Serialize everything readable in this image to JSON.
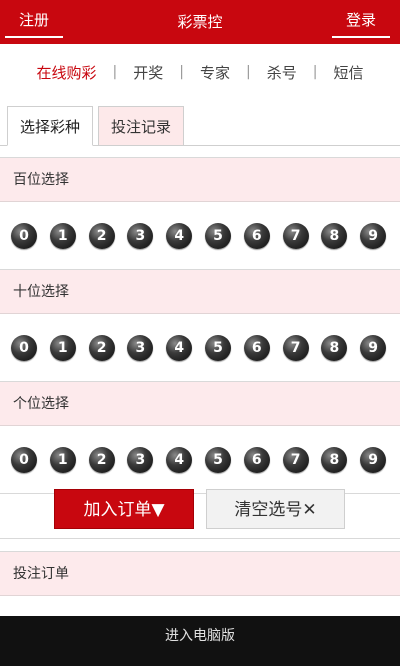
{
  "header": {
    "left_button": "注册",
    "title": "彩票控",
    "right_button": "登录"
  },
  "nav": {
    "items": [
      "在线购彩",
      "开奖",
      "专家",
      "杀号",
      "短信"
    ],
    "active": "在线购彩",
    "separator": "|"
  },
  "tabs": [
    {
      "label": "选择彩种",
      "active": true
    },
    {
      "label": "投注记录",
      "active": false
    }
  ],
  "sections": [
    {
      "title": "百位选择",
      "numbers": [
        "0",
        "1",
        "2",
        "3",
        "4",
        "5",
        "6",
        "7",
        "8",
        "9"
      ]
    },
    {
      "title": "十位选择",
      "numbers": [
        "0",
        "1",
        "2",
        "3",
        "4",
        "5",
        "6",
        "7",
        "8",
        "9"
      ]
    },
    {
      "title": "个位选择",
      "numbers": [
        "0",
        "1",
        "2",
        "3",
        "4",
        "5",
        "6",
        "7",
        "8",
        "9"
      ]
    }
  ],
  "actions": {
    "add_order": "加入订单▼",
    "clear": "清空选号✕"
  },
  "order": {
    "title": "投注订单"
  },
  "footer": {
    "label": "进入电脑版"
  },
  "colors": {
    "brand": "#c8070f",
    "header_bg": "#fdeaec",
    "footer_bg": "#111111"
  }
}
